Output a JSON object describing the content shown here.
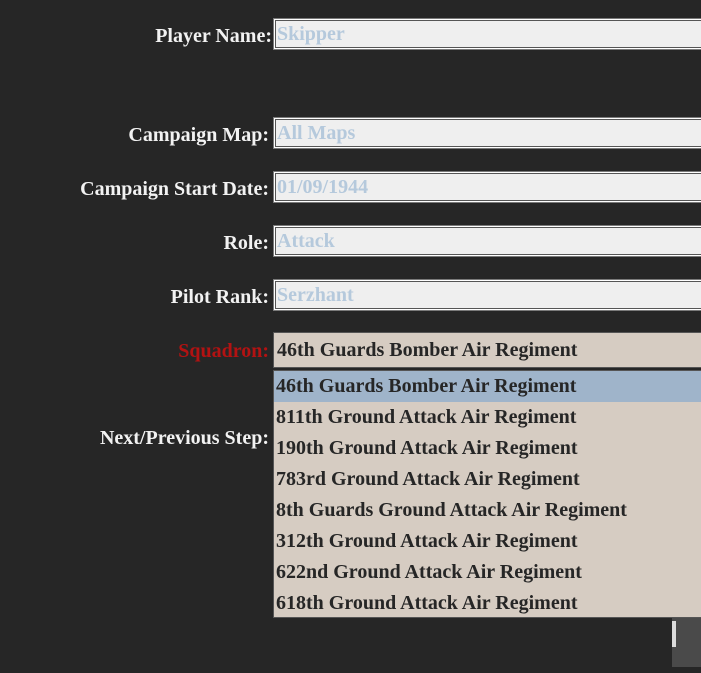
{
  "form": {
    "player_name": {
      "label": "Player Name:",
      "value": "Skipper"
    },
    "campaign_map": {
      "label": "Campaign Map:",
      "value": "All Maps"
    },
    "campaign_start_date": {
      "label": "Campaign Start Date:",
      "value": "01/09/1944"
    },
    "role": {
      "label": "Role:",
      "value": "Attack"
    },
    "pilot_rank": {
      "label": "Pilot Rank:",
      "value": "Serzhant"
    },
    "squadron": {
      "label": "Squadron:",
      "selected": "46th Guards Bomber Air Regiment",
      "options": [
        "46th Guards Bomber Air Regiment",
        "811th Ground Attack Air Regiment",
        "190th Ground Attack Air Regiment",
        "783rd Ground Attack Air Regiment",
        "8th Guards Ground Attack Air Regiment",
        "312th Ground Attack Air Regiment",
        "622nd Ground Attack Air Regiment",
        "618th Ground Attack Air Regiment"
      ]
    },
    "next_previous": {
      "label": "Next/Previous Step:"
    }
  },
  "colors": {
    "background": "#262626",
    "label": "#f2f2f2",
    "required_label": "#b31212",
    "field_bg": "#efefef",
    "field_text": "#b5c9dc",
    "dropdown_bg": "#d6ccc2",
    "highlight": "#9fb4ca"
  }
}
